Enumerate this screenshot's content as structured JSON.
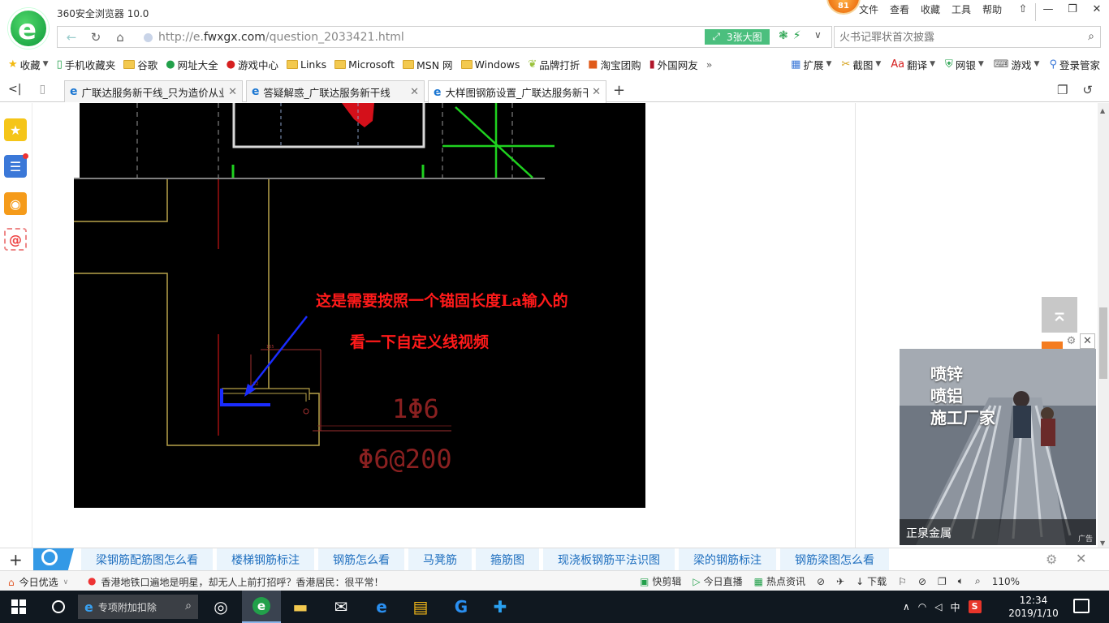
{
  "window": {
    "app_title": "360安全浏览器 10.0",
    "badge": "81",
    "menu": [
      "文件",
      "查看",
      "收藏",
      "工具",
      "帮助"
    ],
    "controls": [
      "⇧",
      "—",
      "❐",
      "✕"
    ]
  },
  "address_bar": {
    "url_prefix": "http://e.",
    "url_domain": "fwxgx.com",
    "url_path": "/question_2033421.html",
    "big_image_button": "3张大图",
    "search_placeholder": "火书记罪状首次披露"
  },
  "bookmarks": {
    "items": [
      "收藏",
      "手机收藏夹",
      "谷歌",
      "网址大全",
      "游戏中心",
      "Links",
      "Microsoft",
      "MSN 网",
      "Windows",
      "品牌打折",
      "淘宝团购",
      "外国网友"
    ],
    "more": "»",
    "right_items": [
      "扩展",
      "截图",
      "翻译",
      "网银",
      "游戏",
      "登录管家"
    ]
  },
  "tabs": [
    {
      "label": "广联达服务新干线_只为造价从业"
    },
    {
      "label": "答疑解惑_广联达服务新干线"
    },
    {
      "label": "大样图钢筋设置_广联达服务新干"
    }
  ],
  "cad": {
    "annotation_line1": "这是需要按照一个锚固长度La输入的",
    "annotation_line2": "看一下自定义线视频",
    "label_1phi6": "1Φ6",
    "label_phi6_200": "Φ6@200"
  },
  "ad": {
    "text": "喷锌\n喷铝\n施工厂家",
    "name": "正泉金属",
    "tag": "广告",
    "to_top": "⌅"
  },
  "keywords": [
    "梁钢筋配筋图怎么看",
    "楼梯钢筋标注",
    "钢筋怎么看",
    "马凳筋",
    "箍筋图",
    "现浇板钢筋平法识图",
    "梁的钢筋标注",
    "钢筋梁图怎么看"
  ],
  "statusbar": {
    "today": "今日优选",
    "news": "香港地铁口遍地是明星，却无人上前打招呼？香港居民：很平常！",
    "items": [
      "快剪辑",
      "今日直播",
      "热点资讯",
      "下载"
    ],
    "zoom": "110%"
  },
  "taskbar": {
    "search_text": "专项附加扣除",
    "time": "12:34",
    "date": "2019/1/10",
    "ime": "中"
  },
  "colors": {
    "annotation_red": "#ff1a1a",
    "arrow_blue": "#1a2cff",
    "keyword_blue": "#1f6fbf",
    "accent_green": "#22a04a"
  }
}
